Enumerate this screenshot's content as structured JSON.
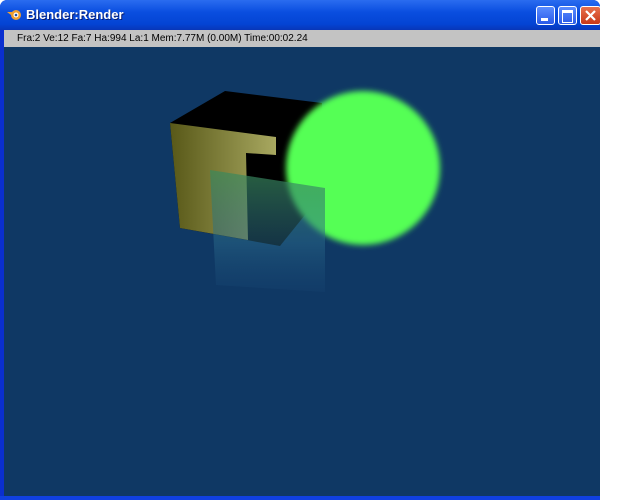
{
  "window": {
    "title": "Blender:Render",
    "icon": "blender-logo-icon"
  },
  "status": {
    "text": "Fra:2  Ve:12 Fa:7 Ha:994 La:1  Mem:7.77M (0.00M) Time:00:02.24"
  },
  "controls": {
    "minimize": "minimize-icon",
    "maximize": "maximize-icon",
    "close": "close-icon"
  },
  "colors": {
    "background": "#0f3864",
    "sphere": "#55ff55",
    "cube": "#6b6a28"
  }
}
